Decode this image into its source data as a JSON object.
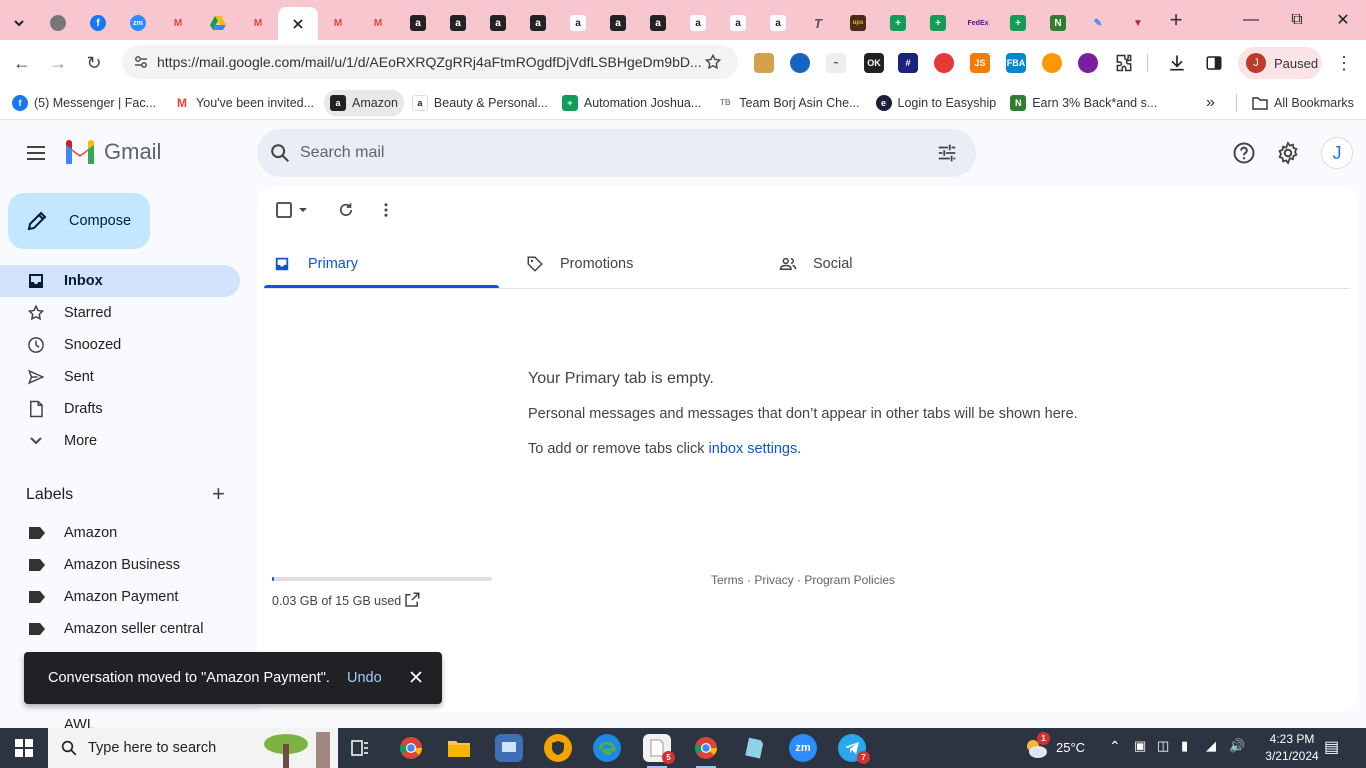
{
  "browser": {
    "url": "https://mail.google.com/mail/u/1/d/AEoRXRQZgRRj4aFtmROgdfDjVdfLSBHgeDm9bD...",
    "profile_label": "Paused",
    "profile_initial": "J",
    "all_bookmarks": "All Bookmarks",
    "bookmarks": [
      {
        "label": "(5) Messenger | Fac...",
        "icon": "facebook-icon",
        "color": "#1877f2"
      },
      {
        "label": "You've been invited...",
        "icon": "gmail-icon",
        "color": "#ea4335"
      },
      {
        "label": "Amazon",
        "icon": "amazon-icon",
        "color": "#222222"
      },
      {
        "label": "Beauty & Personal...",
        "icon": "amazon-icon",
        "color": "#ffffff"
      },
      {
        "label": "Automation Joshua...",
        "icon": "sheets-icon",
        "color": "#0f9d58"
      },
      {
        "label": "Team Borj Asin Che...",
        "icon": "team-icon",
        "color": "#888888"
      },
      {
        "label": "Login to Easyship",
        "icon": "easyship-icon",
        "color": "#1b1f3a"
      },
      {
        "label": "Earn 3% Back*and s...",
        "icon": "earn-icon",
        "color": "#2e7d32"
      }
    ]
  },
  "gmail": {
    "brand": "Gmail",
    "search_placeholder": "Search mail",
    "compose_label": "Compose",
    "nav": [
      {
        "label": "Inbox",
        "icon": "inbox-icon",
        "selected": true
      },
      {
        "label": "Starred",
        "icon": "star-icon"
      },
      {
        "label": "Snoozed",
        "icon": "clock-icon"
      },
      {
        "label": "Sent",
        "icon": "send-icon"
      },
      {
        "label": "Drafts",
        "icon": "draft-icon"
      },
      {
        "label": "More",
        "icon": "chevron-down-icon"
      }
    ],
    "labels_heading": "Labels",
    "labels": [
      "Amazon",
      "Amazon Business",
      "Amazon Payment",
      "Amazon seller central",
      "AWL"
    ],
    "tabs": [
      {
        "label": "Primary",
        "icon": "inbox-tab-icon",
        "active": true
      },
      {
        "label": "Promotions",
        "icon": "tag-icon"
      },
      {
        "label": "Social",
        "icon": "people-icon"
      }
    ],
    "empty": {
      "title": "Your Primary tab is empty.",
      "description": "Personal messages and messages that don’t appear in other tabs will be shown here.",
      "settings_prefix": "To add or remove tabs click ",
      "settings_link": "inbox settings",
      "settings_suffix": "."
    },
    "storage": {
      "text": "0.03 GB of 15 GB used",
      "fraction": 0.002
    },
    "footer": "Terms · Privacy · Program Policies",
    "snackbar": {
      "message": "Conversation moved to \"Amazon Payment\".",
      "undo": "Undo"
    }
  },
  "taskbar": {
    "search_placeholder": "Type here to search",
    "weather": "25°C",
    "time": "4:23 PM",
    "date": "3/21/2024",
    "weather_badge": "1",
    "badges": {
      "app5": "5",
      "telegram": "7"
    }
  },
  "colors": {
    "tabstrip": "#f7c6cf",
    "accent": "#0b57d0",
    "compose": "#c2e7ff",
    "selected_nav": "#d3e3fd"
  }
}
